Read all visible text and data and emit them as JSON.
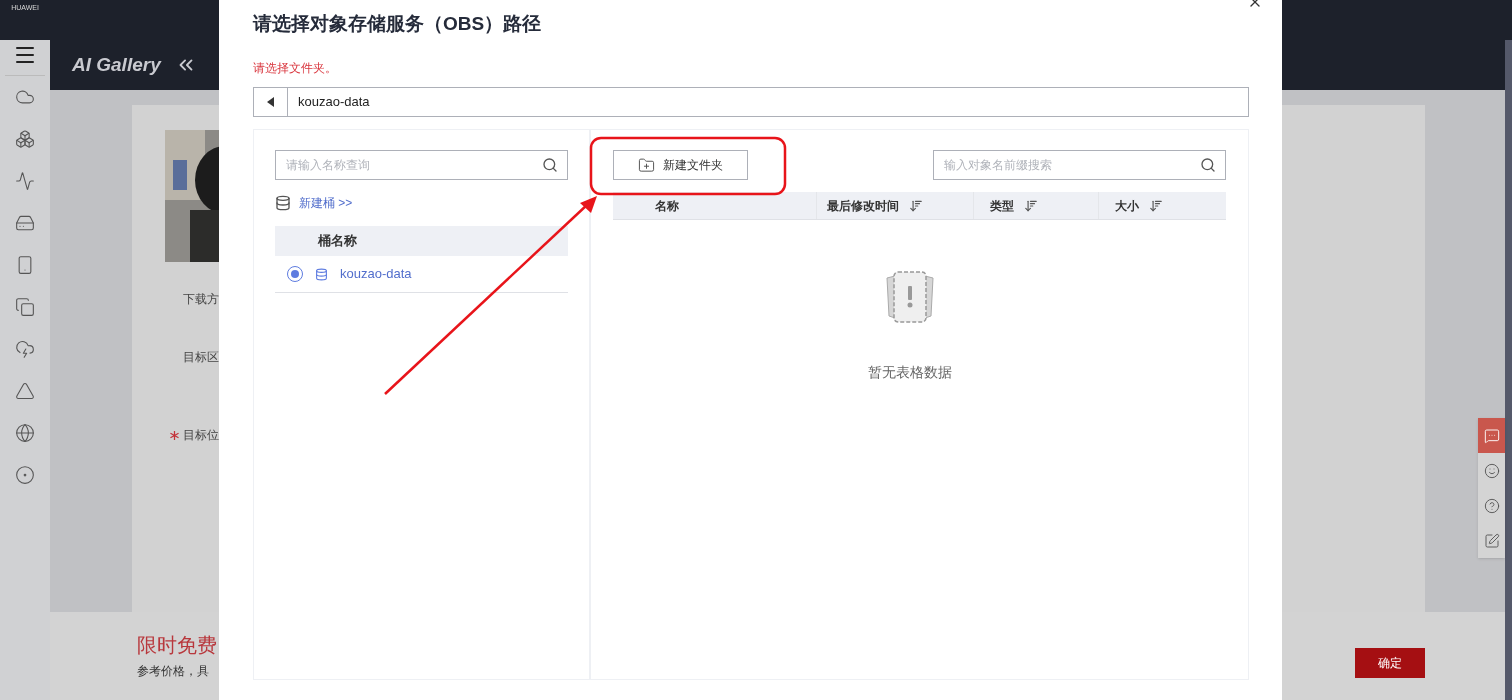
{
  "header": {
    "logo": "HUAWEI",
    "app_title": "AI Gallery"
  },
  "background_form": {
    "labels": [
      {
        "text": "下载方",
        "required": false
      },
      {
        "text": "目标区",
        "required": false
      },
      {
        "text": "目标位",
        "required": true
      }
    ],
    "promo_title": "限时免费",
    "promo_note": "参考价格，具",
    "confirm_button": "确定"
  },
  "modal": {
    "title": "请选择对象存储服务（OBS）路径",
    "hint": "请选择文件夹。",
    "path": "kouzao-data",
    "bucket_search": {
      "placeholder": "请输入名称查询"
    },
    "create_bucket_link": "新建桶 >>",
    "bucket_table": {
      "columns": [
        "桶名称"
      ],
      "rows": [
        {
          "name": "kouzao-data",
          "selected": true
        }
      ]
    },
    "new_folder_button": "新建文件夹",
    "object_search": {
      "placeholder": "输入对象名前缀搜索"
    },
    "object_table": {
      "columns": [
        {
          "label": "名称",
          "sortable": false
        },
        {
          "label": "最后修改时间",
          "sortable": true
        },
        {
          "label": "类型",
          "sortable": true
        },
        {
          "label": "大小",
          "sortable": true
        }
      ],
      "empty_text": "暂无表格数据"
    }
  },
  "help_panel": {
    "items": [
      {
        "kind": "chat",
        "selected": true
      },
      {
        "kind": "feedback",
        "selected": false
      },
      {
        "kind": "help",
        "selected": false
      },
      {
        "kind": "survey",
        "selected": false
      }
    ]
  }
}
